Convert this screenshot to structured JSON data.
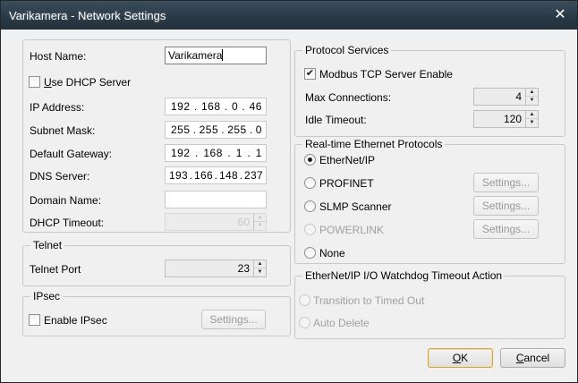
{
  "window": {
    "title": "Varikamera - Network Settings",
    "close_glyph": "✕"
  },
  "network": {
    "host_name_label": "Host Name:",
    "host_name_value": "Varikamera",
    "dhcp_label": "Use DHCP Server",
    "dhcp_checked": false,
    "ip_label": "IP Address:",
    "ip_octets": [
      "192",
      "168",
      "0",
      "46"
    ],
    "subnet_label": "Subnet Mask:",
    "subnet_octets": [
      "255",
      "255",
      "255",
      "0"
    ],
    "gateway_label": "Default Gateway:",
    "gateway_octets": [
      "192",
      "168",
      "1",
      "1"
    ],
    "dns_label": "DNS Server:",
    "dns_octets": [
      "193",
      "166",
      "148",
      "237"
    ],
    "domain_label": "Domain Name:",
    "domain_value": "",
    "dhcp_timeout_label": "DHCP Timeout:",
    "dhcp_timeout_value": "60"
  },
  "telnet": {
    "legend": "Telnet",
    "port_label": "Telnet Port",
    "port_value": "23"
  },
  "ipsec": {
    "legend": "IPsec",
    "enable_label": "Enable IPsec",
    "enable_checked": false,
    "settings_label": "Settings..."
  },
  "protocol": {
    "legend": "Protocol Services",
    "modbus_label": "Modbus TCP Server Enable",
    "modbus_checked": true,
    "check_glyph": "✔",
    "max_conn_label": "Max Connections:",
    "max_conn_value": "4",
    "idle_label": "Idle Timeout:",
    "idle_value": "120"
  },
  "rte": {
    "legend": "Real-time Ethernet Protocols",
    "options": {
      "ethernet_ip": "EtherNet/IP",
      "profinet": "PROFINET",
      "slmp": "SLMP Scanner",
      "powerlink": "POWERLINK",
      "none": "None"
    },
    "selected": "EtherNet/IP",
    "settings_label": "Settings..."
  },
  "watchdog": {
    "legend": "EtherNet/IP I/O Watchdog Timeout Action",
    "transition_label": "Transition to Timed Out",
    "auto_delete_label": "Auto Delete"
  },
  "buttons": {
    "ok": "OK",
    "cancel": "Cancel"
  },
  "icons": {
    "spin_up": "▲",
    "spin_down": "▼"
  },
  "colors": {
    "titlebar": "#2a3946",
    "dialog_bg": "#f0f0f0",
    "default_button_border": "#c8a64a"
  }
}
